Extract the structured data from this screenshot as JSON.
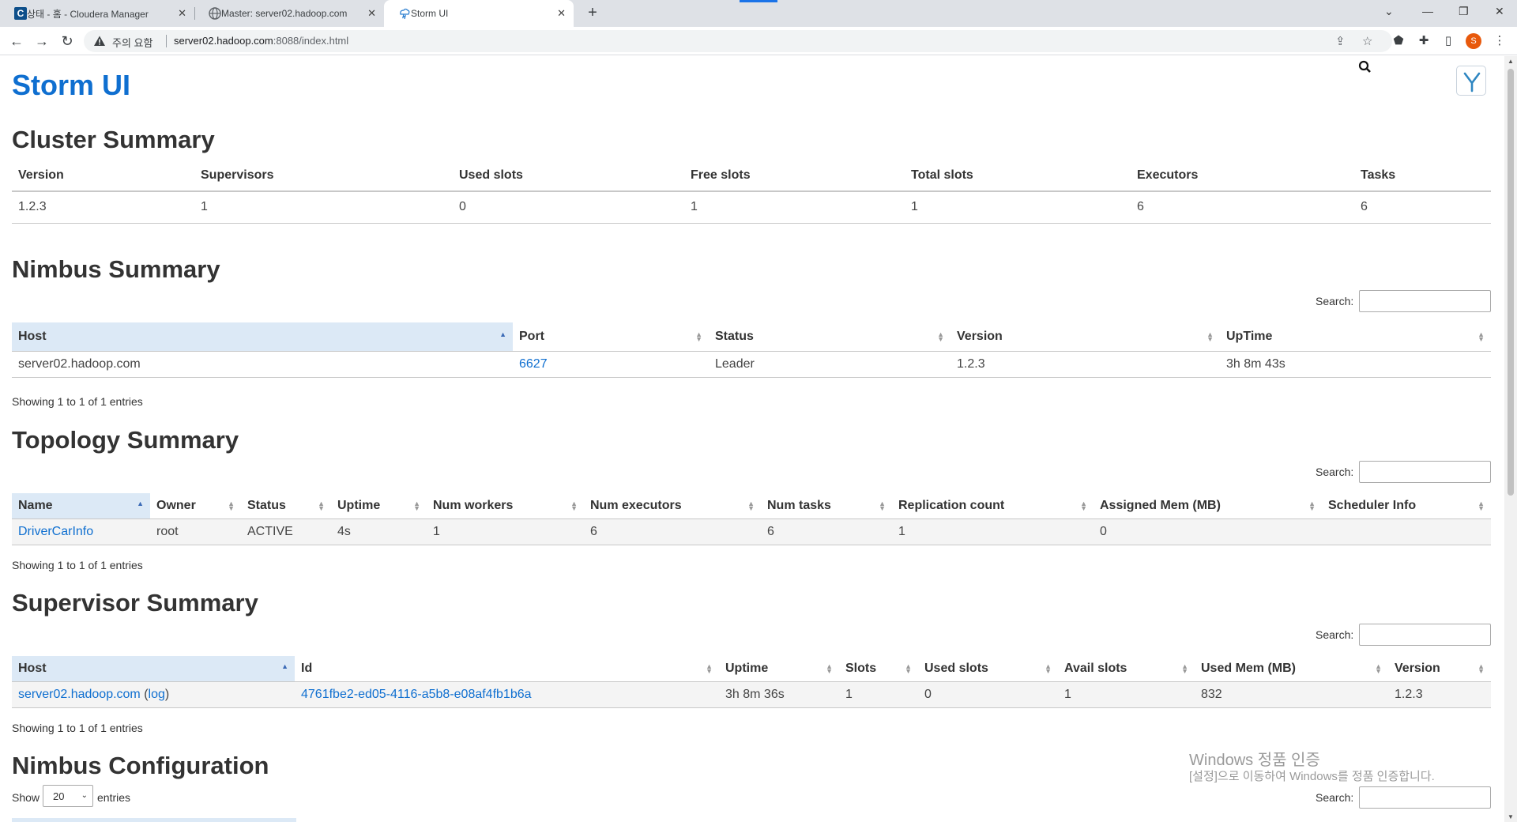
{
  "browser": {
    "tabs": [
      {
        "title": "상태 - 홈 - Cloudera Manager",
        "favicon": "C"
      },
      {
        "title": "Master: server02.hadoop.com"
      },
      {
        "title": "Storm UI"
      }
    ],
    "close_glyph": "✕",
    "new_tab_glyph": "+",
    "warning_text": "주의 요함",
    "url_host": "server02.hadoop.com",
    "url_path": ":8088/index.html",
    "profile_initial": "S"
  },
  "page": {
    "title": "Storm UI",
    "search_label": "Search:",
    "cluster": {
      "heading": "Cluster Summary",
      "headers": [
        "Version",
        "Supervisors",
        "Used slots",
        "Free slots",
        "Total slots",
        "Executors",
        "Tasks"
      ],
      "row": [
        "1.2.3",
        "1",
        "0",
        "1",
        "1",
        "6",
        "6"
      ]
    },
    "nimbus": {
      "heading": "Nimbus Summary",
      "headers": [
        "Host",
        "Port",
        "Status",
        "Version",
        "UpTime"
      ],
      "row": [
        "server02.hadoop.com",
        "6627",
        "Leader",
        "1.2.3",
        "3h 8m 43s"
      ],
      "info": "Showing 1 to 1 of 1 entries"
    },
    "topology": {
      "heading": "Topology Summary",
      "headers": [
        "Name",
        "Owner",
        "Status",
        "Uptime",
        "Num workers",
        "Num executors",
        "Num tasks",
        "Replication count",
        "Assigned Mem (MB)",
        "Scheduler Info"
      ],
      "row": [
        "DriverCarInfo",
        "root",
        "ACTIVE",
        "4s",
        "1",
        "6",
        "6",
        "1",
        "0",
        ""
      ],
      "info": "Showing 1 to 1 of 1 entries"
    },
    "supervisor": {
      "heading": "Supervisor Summary",
      "headers": [
        "Host",
        "Id",
        "Uptime",
        "Slots",
        "Used slots",
        "Avail slots",
        "Used Mem (MB)",
        "Version"
      ],
      "host": "server02.hadoop.com",
      "log_link": "log",
      "row": [
        "4761fbe2-ed05-4116-a5b8-e08af4fb1b6a",
        "3h 8m 36s",
        "1",
        "0",
        "1",
        "832",
        "1.2.3"
      ],
      "info": "Showing 1 to 1 of 1 entries"
    },
    "nimbus_config": {
      "heading": "Nimbus Configuration",
      "show_label": "Show",
      "page_size": "20",
      "entries_label": "entries"
    },
    "watermark": {
      "line1": "Windows 정품 인증",
      "line2": "[설정]으로 이동하여 Windows를 정품 인증합니다."
    }
  }
}
